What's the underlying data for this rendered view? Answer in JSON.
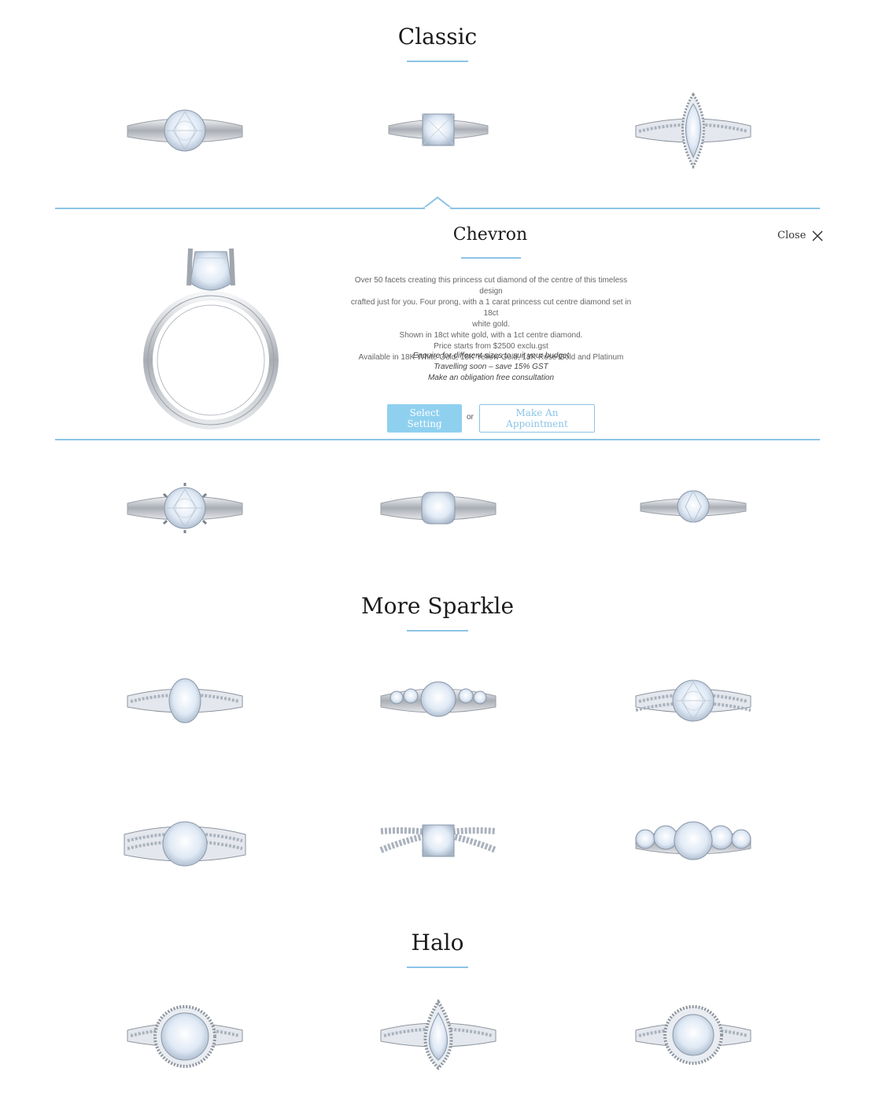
{
  "sections": {
    "classic": "Classic",
    "more_sparkle": "More Sparkle",
    "halo": "Halo"
  },
  "detail": {
    "title": "Chevron",
    "close_label": "Close",
    "description": [
      "Over 50 facets creating this princess cut diamond of the centre of this timeless design",
      "crafted just for you. Four prong, with a 1 carat princess cut centre diamond set in 18ct",
      "white gold.",
      "Shown in 18ct white gold, with a 1ct centre diamond.",
      "Price starts from $2500 exclu.gst",
      "Available in 18K White Gold, 18K Yellow Gold, 18K Rose Gold and Platinum"
    ],
    "notes": [
      "Enquire for different sizes to suit your budget",
      "Travelling soon – save 15% GST",
      "Make an obligation free consultation"
    ],
    "select_button": "Select Setting",
    "or_text": "or",
    "appointment_button": "Make An Appointment"
  },
  "colors": {
    "accent": "#8cc4e6",
    "button": "#8fd0ef"
  },
  "rings": {
    "classic_row1": [
      "round-solitaire",
      "princess-solitaire",
      "marquise-halo"
    ],
    "classic_row2": [
      "six-prong-solitaire",
      "cushion-solitaire",
      "six-prong-small"
    ],
    "sparkle_row1": [
      "oval-pave",
      "round-side-stones",
      "split-shank-pave"
    ],
    "sparkle_row2": [
      "triple-row-pave",
      "crossover-princess",
      "five-stone"
    ],
    "halo_row1": [
      "round-halo-split",
      "pear-halo",
      "round-halo"
    ]
  }
}
